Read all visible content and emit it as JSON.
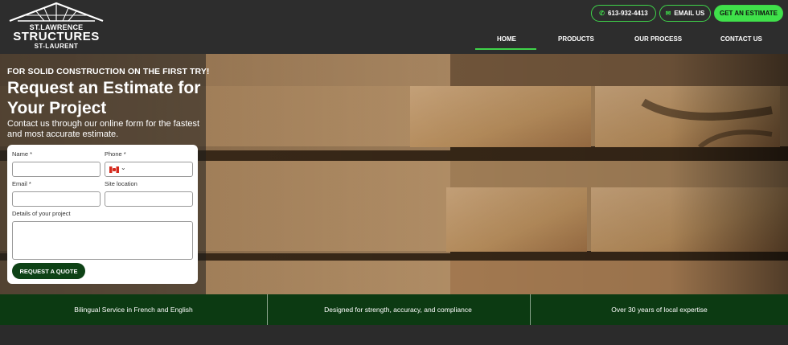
{
  "logo": {
    "line1": "ST.LAWRENCE",
    "line2": "STRUCTURES",
    "line3": "ST-LAURENT"
  },
  "header": {
    "phone": "613-932-4413",
    "email_label": "EMAIL US",
    "estimate_label": "GET AN ESTIMATE"
  },
  "nav": {
    "items": [
      "HOME",
      "PRODUCTS",
      "OUR PROCESS",
      "CONTACT US"
    ],
    "active": "HOME"
  },
  "hero": {
    "tagline": "FOR SOLID CONSTRUCTION ON THE FIRST TRY!",
    "title": "Request an Estimate for Your Project",
    "subtitle": "Contact us through our online form for the fastest and most accurate estimate."
  },
  "form": {
    "name_label": "Name *",
    "phone_label": "Phone *",
    "email_label": "Email *",
    "site_label": "Site location",
    "details_label": "Details of your project",
    "submit_label": "REQUEST A QUOTE"
  },
  "features": [
    "Bilingual Service in French and  English",
    "Designed for strength, accuracy, and compliance",
    "Over 30 years of local expertise"
  ],
  "colors": {
    "accent": "#3fd44a",
    "dark_green": "#0c3a12",
    "header_bg": "#2d2d2d"
  },
  "icons": {
    "phone": "phone-icon",
    "email": "envelope-icon",
    "flag": "canada-flag-icon"
  }
}
